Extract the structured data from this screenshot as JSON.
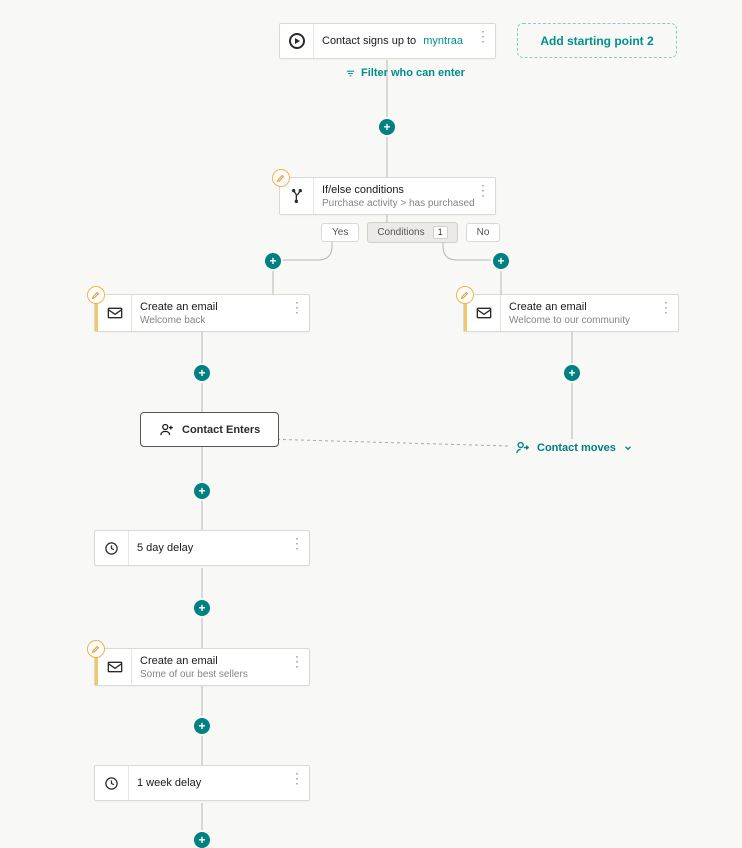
{
  "colors": {
    "teal": "#008080",
    "gold": "#f3b24c",
    "link": "#008e8e"
  },
  "add_starting_point": {
    "label": "Add starting point 2"
  },
  "nodes": {
    "start": {
      "title_prefix": "Contact signs up to",
      "list_link": "myntraa"
    },
    "filter": {
      "label": "Filter who can enter"
    },
    "ifelse": {
      "title": "If/else conditions",
      "subtitle": "Purchase activity > has purchased"
    },
    "branch": {
      "yes": "Yes",
      "no": "No",
      "conditions_label": "Conditions",
      "conditions_count": "1"
    },
    "email_yes": {
      "title": "Create an email",
      "subtitle": "Welcome back"
    },
    "email_no": {
      "title": "Create an email",
      "subtitle": "Welcome to our community"
    },
    "contact_enters": {
      "label": "Contact Enters"
    },
    "contact_moves": {
      "label": "Contact moves"
    },
    "delay1": {
      "title": "5 day delay"
    },
    "email_best": {
      "title": "Create an email",
      "subtitle": "Some of our best sellers"
    },
    "delay2": {
      "title": "1 week delay"
    }
  }
}
